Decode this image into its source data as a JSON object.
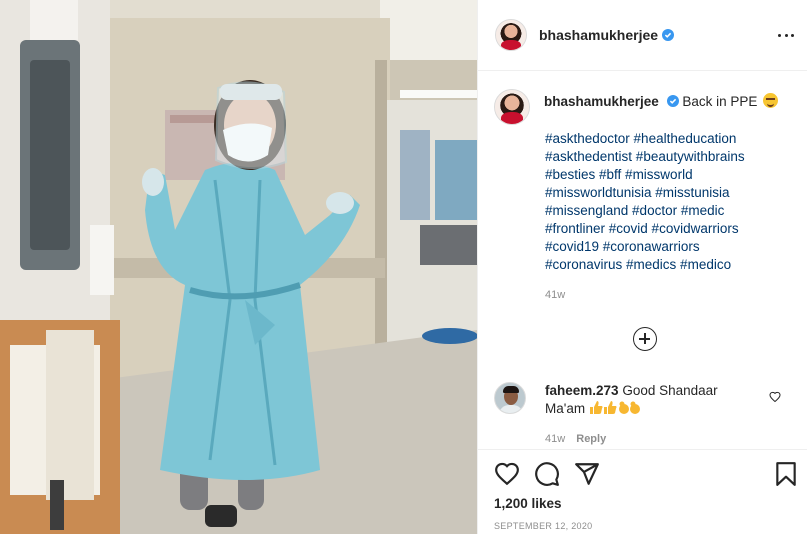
{
  "photo": {
    "alt": "",
    "subject_colors": {
      "gown": "#7ec6d6",
      "wall": "#d6ceb9",
      "floor": "#c8c2b6"
    }
  },
  "header": {
    "username": "bhashamukherjee",
    "verified": true
  },
  "caption": {
    "username": "bhashamukherjee",
    "text": "Back in PPE",
    "emoji": "smirking-face",
    "hashtags": [
      "#askthedoctor #healtheducation",
      "#askthedentist #beautywithbrains",
      "#besties #bff #missworld",
      "#missworldtunisia #misstunisia",
      "#missengland #doctor #medic",
      "#frontliner #covid #covidwarriors",
      "#covid19 #coronawarriors",
      "#coronavirus #medics #medico"
    ],
    "time": "41w"
  },
  "comment": {
    "username": "faheem.273",
    "text": "Good Shandaar",
    "text2": "Ma'am",
    "emojis": "thumbs-up-and-ok-hands",
    "time": "41w",
    "reply_label": "Reply"
  },
  "actions": {
    "likes": "1,200 likes",
    "date": "SEPTEMBER 12, 2020"
  },
  "colors": {
    "accent": "#0095f6",
    "hashtag": "#00376b",
    "muted": "#8e8e8e",
    "text": "#262626"
  }
}
